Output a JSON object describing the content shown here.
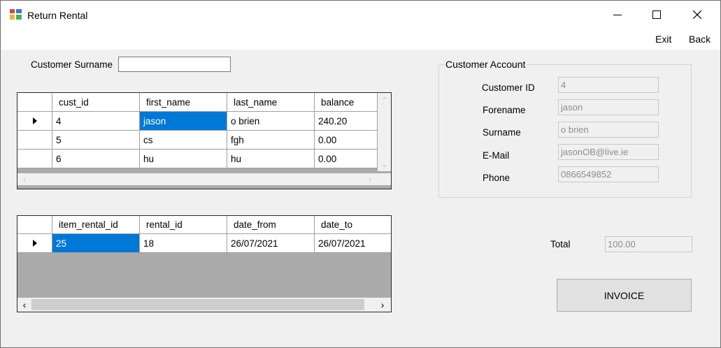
{
  "window": {
    "title": "Return Rental"
  },
  "menu": {
    "exit": "Exit",
    "back": "Back"
  },
  "search": {
    "label": "Customer Surname",
    "value": ""
  },
  "customers_grid": {
    "columns": [
      "cust_id",
      "first_name",
      "last_name",
      "balance"
    ],
    "rows": [
      [
        "4",
        "jason",
        "o brien",
        "240.20"
      ],
      [
        "5",
        "cs",
        "fgh",
        "0.00"
      ],
      [
        "6",
        "hu",
        "hu",
        "0.00"
      ]
    ]
  },
  "rentals_grid": {
    "columns": [
      "item_rental_id",
      "rental_id",
      "date_from",
      "date_to"
    ],
    "rows": [
      [
        "25",
        "18",
        "26/07/2021",
        "26/07/2021"
      ]
    ]
  },
  "account": {
    "title": "Customer Account",
    "customer_id_label": "Customer ID",
    "customer_id": "4",
    "forename_label": "Forename",
    "forename": "jason",
    "surname_label": "Surname",
    "surname": "o brien",
    "email_label": "E-Mail",
    "email": "jasonOB@live.ie",
    "phone_label": "Phone",
    "phone": "0866549852"
  },
  "total": {
    "label": "Total",
    "value": "100.00"
  },
  "invoice_button": "INVOICE"
}
